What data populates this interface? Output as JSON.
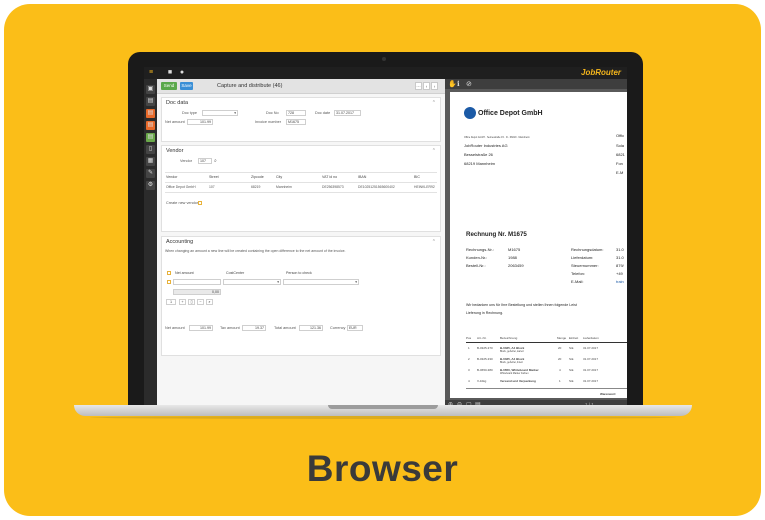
{
  "caption": "Browser",
  "app": {
    "brand": "JobRouter",
    "toolbar": {
      "send_label": "Send",
      "save_label": "Save",
      "title": "Capture and distribute (46)"
    },
    "doc_data": {
      "title": "Doc data",
      "doc_type_label": "Doc type",
      "doc_no_label": "Doc No",
      "doc_no_value": "728",
      "doc_date_label": "Doc date",
      "doc_date_value": "31.07.2017",
      "net_amount_label": "Net amount",
      "net_amount_value": "101.99",
      "invoice_number_label": "Invoice number",
      "invoice_number_value": "M1675"
    },
    "vendor": {
      "title": "Vendor",
      "vendor_label": "Vendor",
      "vendor_value": "107",
      "columns": [
        "Vendor",
        "Street",
        "Zipcode",
        "City",
        "VAT id no",
        "IBAN",
        "BIC"
      ],
      "row": [
        "Office Depot GmbH",
        "107",
        "68219",
        "Mannheim",
        "DE256398573",
        "DE10251251565600402",
        "HEINKLER92"
      ],
      "create_new_label": "Create new vendor"
    },
    "accounting": {
      "title": "Accounting",
      "note": "When changing an amount a new line will be created containing the open difference to the net amount of the invoice.",
      "columns": [
        "Net amount",
        "CostCenter",
        "Person to check"
      ],
      "sum_value": "0,00",
      "net_amount_label": "Net amount",
      "net_amount_value": "101.99",
      "tax_amount_label": "Tax amount",
      "tax_amount_value": "19.37",
      "total_amount_label": "Total amount",
      "total_amount_value": "121.36",
      "currency_label": "Currency",
      "currency_value": "EUR",
      "page_value": "1"
    },
    "document": {
      "company": "Office Depot GmbH",
      "sender_line": "Office Depot GmbH · Seimestraße 15 · D - 68219 · Mannheim",
      "recipient": [
        "JobRouter Industries AG",
        "Besselstraße 26",
        "68219 Mannheim"
      ],
      "right_col": [
        "Offic",
        "Sola",
        "6821",
        "Fon",
        "E-M"
      ],
      "invoice_title": "Rechnung Nr. M1675",
      "meta_left": [
        {
          "k": "Rechnungs-Nr.:",
          "v": "M1675"
        },
        {
          "k": "Kunden-Nr.:",
          "v": "1988"
        },
        {
          "k": "Bestell-Nr.:",
          "v": "2063459"
        }
      ],
      "meta_right": [
        {
          "k": "Rechnungsdatum:",
          "v": "31.0"
        },
        {
          "k": "Lieferdatum:",
          "v": "31.0"
        },
        {
          "k": "Steuernummer:",
          "v": "879/"
        },
        {
          "k": "Telefon:",
          "v": "+49"
        },
        {
          "k": "E-Mail:",
          "v": "train"
        }
      ],
      "body_line1": "Wir bedanken uns für Ihre Bestellung und stellen Ihnen folgende Leist",
      "body_line2": "Lieferung in Rechnung.",
      "table_head": [
        "Pos",
        "Art.-Nr.",
        "Bezeichnung",
        "Menge",
        "Einheit",
        "Lieferdatum"
      ],
      "rows": [
        {
          "pos": "1",
          "art": "B-0325-370",
          "name": "B-0325, A4 Block",
          "sub": "Block, geheftet, kariert",
          "qty": "20",
          "unit": "Stk.",
          "date": "31.07.2017"
        },
        {
          "pos": "2",
          "art": "B-0325-330",
          "name": "B-0325, A4 Block",
          "sub": "Block, geheftet, liniert",
          "qty": "20",
          "unit": "Stk.",
          "date": "31.07.2017"
        },
        {
          "pos": "3",
          "art": "B-0650-380",
          "name": "B-0650, Whiteboard Marker",
          "sub": "Whiteboard Marker Farben",
          "qty": "4",
          "unit": "Stk.",
          "date": "31.07.2017"
        },
        {
          "pos": "4",
          "art": "V-10kg",
          "name": "Versand und Verpackung",
          "sub": "",
          "qty": "1",
          "unit": "Stk.",
          "date": "31.07.2017"
        }
      ],
      "footer": "Warenwert:"
    },
    "viewer": {
      "page_indicator": "1 / 1"
    }
  },
  "colors": {
    "card": "#fbbe18",
    "caption": "#3a3a3a",
    "send": "#5aa84a",
    "save": "#3a8fd6",
    "brand": "#f3b51c"
  }
}
